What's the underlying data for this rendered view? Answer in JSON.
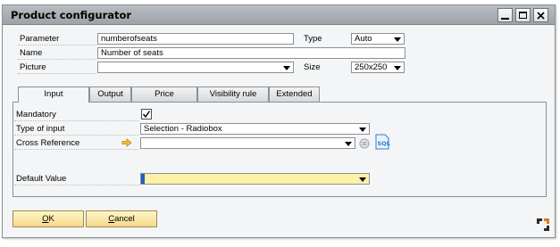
{
  "window": {
    "title": "Product configurator"
  },
  "header_fields": {
    "parameter_label": "Parameter",
    "parameter_value": "numberofseats",
    "type_label": "Type",
    "type_value": "Auto",
    "name_label": "Name",
    "name_value": "Number of seats",
    "picture_label": "Picture",
    "picture_value": "",
    "size_label": "Size",
    "size_value": "250x250"
  },
  "tabs": [
    {
      "label": "Input"
    },
    {
      "label": "Output"
    },
    {
      "label": "Price"
    },
    {
      "label": "Visibility rule"
    },
    {
      "label": "Extended"
    }
  ],
  "input_tab": {
    "mandatory_label": "Mandatory",
    "mandatory_checked": true,
    "type_of_input_label": "Type of input",
    "type_of_input_value": "Selection - Radiobox",
    "cross_reference_label": "Cross Reference",
    "cross_reference_value": "",
    "default_value_label": "Default Value",
    "default_value": ""
  },
  "buttons": {
    "ok": "OK",
    "cancel": "Cancel"
  },
  "colors": {
    "titlebar": "#a9aeb4",
    "button_fill": "#f6d88a",
    "highlight_field": "#fff0a8",
    "arrow_icon": "#e0b020",
    "sql_icon": "#2a7fd0"
  },
  "icons": [
    "minimize-icon",
    "maximize-icon",
    "close-icon",
    "link-arrow-icon",
    "lookup-icon",
    "sql-icon",
    "resize-icon"
  ]
}
